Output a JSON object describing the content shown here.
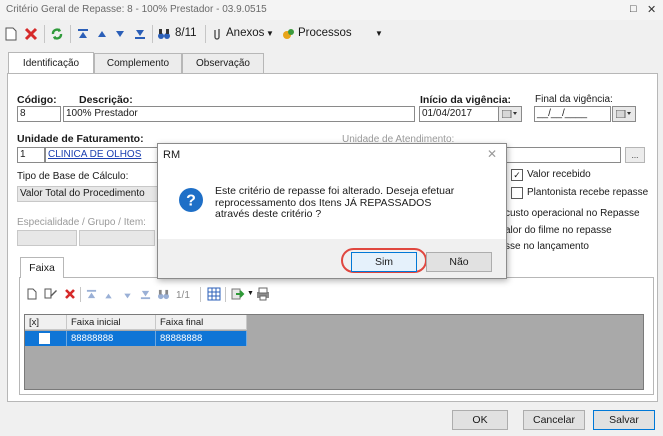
{
  "window": {
    "title": "Critério Geral de Repasse: 8 - 100% Prestador - 03.9.0515",
    "controls": [
      "□",
      "✕"
    ]
  },
  "toolbar": {
    "record_counter": "8/11",
    "anexos_label": "Anexos",
    "processos_label": "Processos"
  },
  "tabs": [
    "Identificação",
    "Complemento",
    "Observação"
  ],
  "form": {
    "codigo_label": "Código:",
    "codigo_value": "8",
    "descricao_label": "Descrição:",
    "descricao_value": "100% Prestador",
    "inicio_vigencia_label": "Início da vigência:",
    "inicio_vigencia_value": "01/04/2017",
    "final_vigencia_label": "Final da vigência:",
    "final_vigencia_value": "__/__/____",
    "unidade_faturamento_label": "Unidade de Faturamento:",
    "unidade_faturamento_code": "1",
    "unidade_faturamento_name": "CLINICA DE OLHOS",
    "unidade_atendimento_label": "Unidade de Atendimento:",
    "tipo_base_label": "Tipo de Base de Cálculo:",
    "tipo_base_value": "Valor Total do Procedimento",
    "especialidade_label": "Especialidade / Grupo / Item:",
    "ellipsis_button": "..."
  },
  "checkboxes": [
    {
      "label": "Valor recebido",
      "checked": true
    },
    {
      "label": "Plantonista recebe repasse",
      "checked": false
    }
  ],
  "partial_options": [
    "custo operacional no Repasse",
    "alor do filme no repasse",
    "sse no lançamento"
  ],
  "faixa": {
    "tab_label": "Faixa",
    "record_counter": "1/1",
    "columns": [
      "[x]",
      "Faixa inicial",
      "Faixa final"
    ],
    "rows": [
      {
        "selected": false,
        "faixa_inicial": "88888888",
        "faixa_final": "88888888"
      }
    ]
  },
  "footer": {
    "ok_label": "OK",
    "cancel_label": "Cancelar",
    "save_label": "Salvar"
  },
  "dialog": {
    "title": "RM",
    "message": "Este critério de repasse foi alterado. Deseja efetuar reprocessamento dos Itens JÁ REPASSADOS através deste critério ?",
    "yes_label": "Sim",
    "no_label": "Não",
    "highlight_color": "#e0473f"
  },
  "colors": {
    "selection_blue": "#0f75d6",
    "link_blue": "#1a3fb0",
    "question_icon": "#1e6fc7"
  }
}
